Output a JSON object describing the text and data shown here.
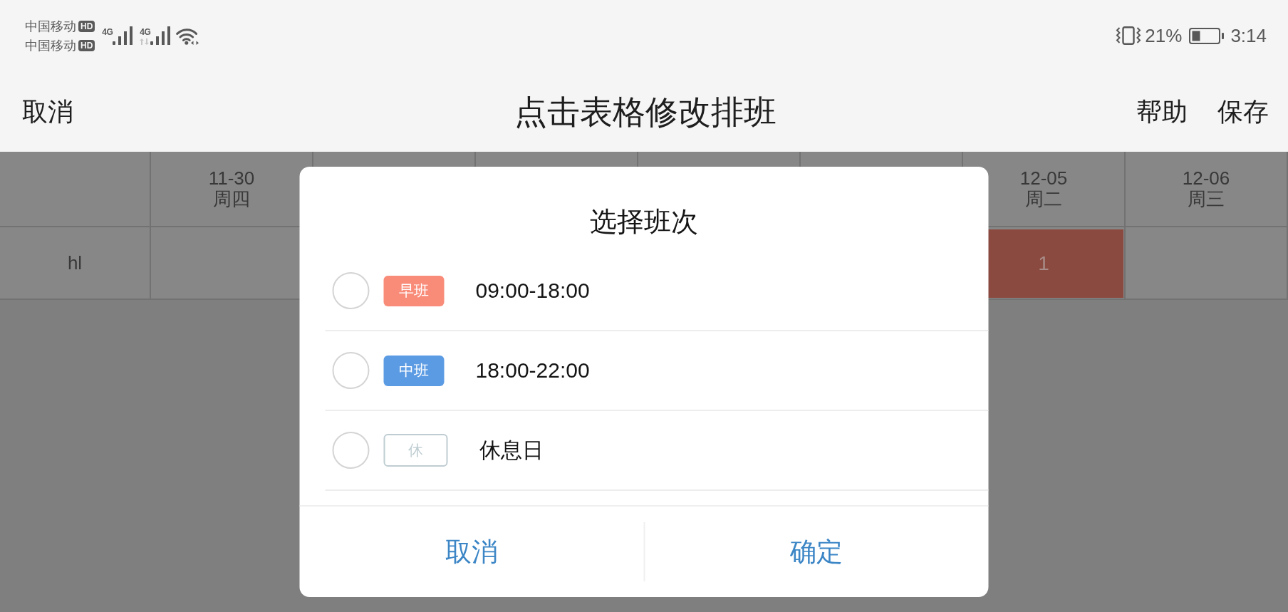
{
  "status_bar": {
    "carriers": [
      {
        "name": "中国移动",
        "badge": "HD"
      },
      {
        "name": "中国移动",
        "badge": "HD"
      }
    ],
    "networks": [
      {
        "type": "4G",
        "data_active": false
      },
      {
        "type": "4G",
        "data_active": true
      }
    ],
    "battery_percent": "21%",
    "time": "3:14"
  },
  "nav_bar": {
    "left_action": "取消",
    "title": "点击表格修改排班",
    "right_actions": [
      "帮助",
      "保存"
    ]
  },
  "table": {
    "columns_before_dialog": [
      {
        "date": "11-30",
        "weekday": "周四"
      }
    ],
    "columns_after_dialog": [
      {
        "date": "12-05",
        "weekday": "周二"
      },
      {
        "date": "12-06",
        "weekday": "周三"
      }
    ],
    "rows": [
      {
        "name": "hl",
        "cells_before_dialog": [
          {
            "kind": "empty"
          }
        ],
        "cells_after_dialog": [
          {
            "kind": "shift",
            "text": "1",
            "color": "#8b4a40"
          },
          {
            "kind": "empty"
          }
        ]
      }
    ]
  },
  "dialog": {
    "title": "选择班次",
    "options": [
      {
        "kind": "filled",
        "tag": "早班",
        "color": "#f98b79",
        "label": "09:00-18:00",
        "selected": false
      },
      {
        "kind": "filled",
        "tag": "中班",
        "color": "#5b9be3",
        "label": "18:00-22:00",
        "selected": false
      },
      {
        "kind": "outline",
        "tag": "休",
        "color": "#bfcdd2",
        "label": "休息日",
        "selected": false
      }
    ],
    "buttons": [
      "取消",
      "确定"
    ]
  }
}
